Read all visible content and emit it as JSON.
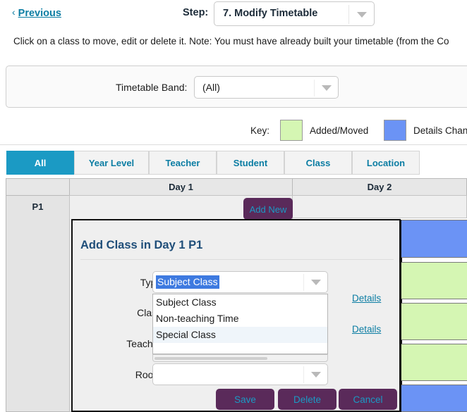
{
  "topbar": {
    "previous_label": "Previous",
    "previous_chevron": "‹",
    "step_label": "Step:",
    "step_value": "7. Modify Timetable"
  },
  "instruction": "Click on a class to move, edit or delete it. Note: You must have already built your timetable (from the Co",
  "band_panel": {
    "label": "Timetable Band:",
    "value": "(All)"
  },
  "key": {
    "label": "Key:",
    "added_moved_label": "Added/Moved",
    "added_moved_color": "#d5f6b3",
    "details_changed_label": "Details Chan",
    "details_changed_color": "#6b93f5"
  },
  "tabs": [
    {
      "label": "All",
      "active": true
    },
    {
      "label": "Year Level",
      "active": false
    },
    {
      "label": "Teacher",
      "active": false
    },
    {
      "label": "Student",
      "active": false
    },
    {
      "label": "Class",
      "active": false
    },
    {
      "label": "Location",
      "active": false
    }
  ],
  "grid": {
    "corner_label": "",
    "day_headers": [
      "Day 1",
      "Day 2"
    ],
    "period_label": "P1",
    "add_new_label": "Add New",
    "day2_cells": [
      {
        "status": "details-changed",
        "color": "#6b93f5"
      },
      {
        "status": "added-moved",
        "color": "#d5f6b3"
      },
      {
        "status": "added-moved",
        "color": "#d5f6b3"
      },
      {
        "status": "added-moved",
        "color": "#d5f6b3"
      },
      {
        "status": "details-changed",
        "color": "#6b93f5"
      }
    ]
  },
  "modal": {
    "title": "Add Class in Day 1 P1",
    "fields": {
      "type_label": "Type:",
      "type_value": "Subject Class",
      "class_label": "Class:",
      "teacher_label": "Teacher:",
      "room_label": "Room:",
      "room_value": ""
    },
    "type_options": [
      {
        "label": "Subject Class",
        "hover": false
      },
      {
        "label": "Non-teaching Time",
        "hover": false
      },
      {
        "label": "Special Class",
        "hover": true
      }
    ],
    "details_class_link": "Details",
    "details_teacher_link": "Details",
    "buttons": {
      "save": "Save",
      "delete": "Delete",
      "cancel": "Cancel"
    },
    "accent_color": "#5a2a5a",
    "button_text_color": "#1b9ac4"
  }
}
